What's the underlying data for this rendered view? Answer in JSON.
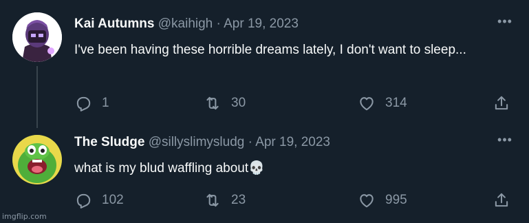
{
  "tweets": [
    {
      "display_name": "Kai Autumns",
      "handle": "@kaihigh",
      "separator": "·",
      "date": "Apr 19, 2023",
      "text": "I've been having these horrible dreams lately, I don't want to sleep...",
      "replies": "1",
      "retweets": "30",
      "likes": "314",
      "more": "•••"
    },
    {
      "display_name": "The Sludge",
      "handle": "@sillyslimysludg",
      "separator": "·",
      "date": "Apr 19, 2023",
      "text": "what is my blud waffling about💀",
      "replies": "102",
      "retweets": "23",
      "likes": "995",
      "more": "•••"
    }
  ],
  "watermark": "imgflip.com",
  "colors": {
    "background": "#15202b",
    "text": "#f7f9f9",
    "muted": "#8b98a5",
    "thread_line": "#38444d"
  },
  "icons": [
    "reply-icon",
    "retweet-icon",
    "like-icon",
    "share-icon",
    "more-icon"
  ]
}
